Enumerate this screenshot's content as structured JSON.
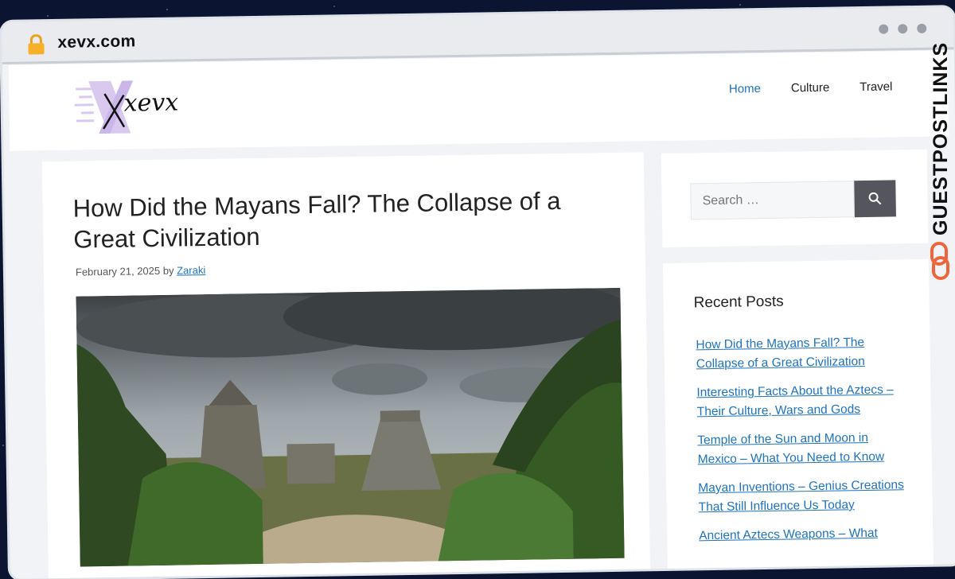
{
  "browser": {
    "url": "xevx.com"
  },
  "header": {
    "logo_text": "xevx",
    "nav": [
      {
        "label": "Home",
        "active": true
      },
      {
        "label": "Culture",
        "active": false
      },
      {
        "label": "Travel",
        "active": false
      }
    ]
  },
  "article": {
    "title": "How Did the Mayans Fall? The Collapse of a Great Civilization",
    "date": "February 21, 2025",
    "by": "by",
    "author": "Zaraki"
  },
  "sidebar": {
    "search_placeholder": "Search …",
    "recent_title": "Recent Posts",
    "recent_posts": [
      "How Did the Mayans Fall? The Collapse of a Great Civilization",
      "Interesting Facts About the Aztecs – Their Culture, Wars and Gods",
      "Temple of the Sun and Moon in Mexico – What You Need to Know",
      "Mayan Inventions – Genius Creations That Still Influence Us Today",
      "Ancient Aztecs Weapons – What"
    ]
  },
  "watermark": {
    "text": "GUESTPOSTLINKS"
  },
  "colors": {
    "link": "#1e73be",
    "search_button": "#55555e",
    "badge_orange": "#f0643c"
  }
}
